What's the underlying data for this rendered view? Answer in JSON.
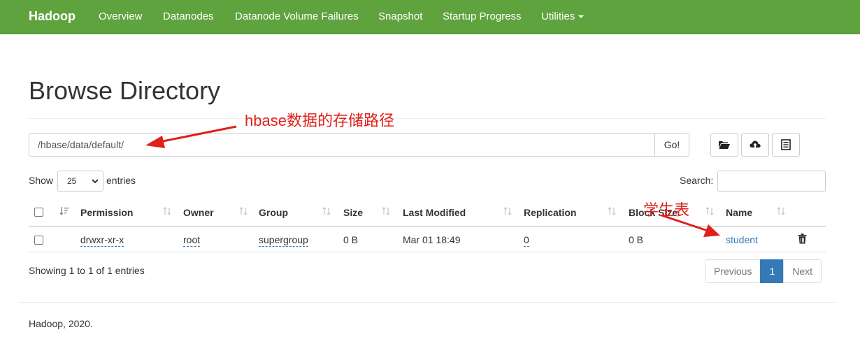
{
  "navbar": {
    "brand": "Hadoop",
    "items": [
      "Overview",
      "Datanodes",
      "Datanode Volume Failures",
      "Snapshot",
      "Startup Progress",
      "Utilities"
    ]
  },
  "page": {
    "title": "Browse Directory"
  },
  "path_bar": {
    "value": "/hbase/data/default/",
    "go_label": "Go!"
  },
  "toolbar": {
    "icons": [
      "folder-open-icon",
      "cloud-upload-icon",
      "list-icon"
    ]
  },
  "table_controls": {
    "show_label": "Show",
    "entries_value": "25",
    "entries_label": "entries",
    "search_label": "Search:"
  },
  "table": {
    "columns": [
      "Permission",
      "Owner",
      "Group",
      "Size",
      "Last Modified",
      "Replication",
      "Block Size",
      "Name"
    ],
    "rows": [
      {
        "permission": "drwxr-xr-x",
        "owner": "root",
        "group": "supergroup",
        "size": "0 B",
        "last_modified": "Mar 01 18:49",
        "replication": "0",
        "block_size": "0 B",
        "name": "student"
      }
    ]
  },
  "table_footer": {
    "info": "Showing 1 to 1 of 1 entries",
    "pagination": {
      "previous": "Previous",
      "current": "1",
      "next": "Next"
    }
  },
  "footer": {
    "text": "Hadoop, 2020."
  },
  "annotations": {
    "path_note": "hbase数据的存储路径",
    "table_note": "学生表",
    "color": "#e0201a"
  },
  "colors": {
    "navbar": "#5fa33e",
    "link": "#337ab7",
    "accent": "#337ab7"
  }
}
